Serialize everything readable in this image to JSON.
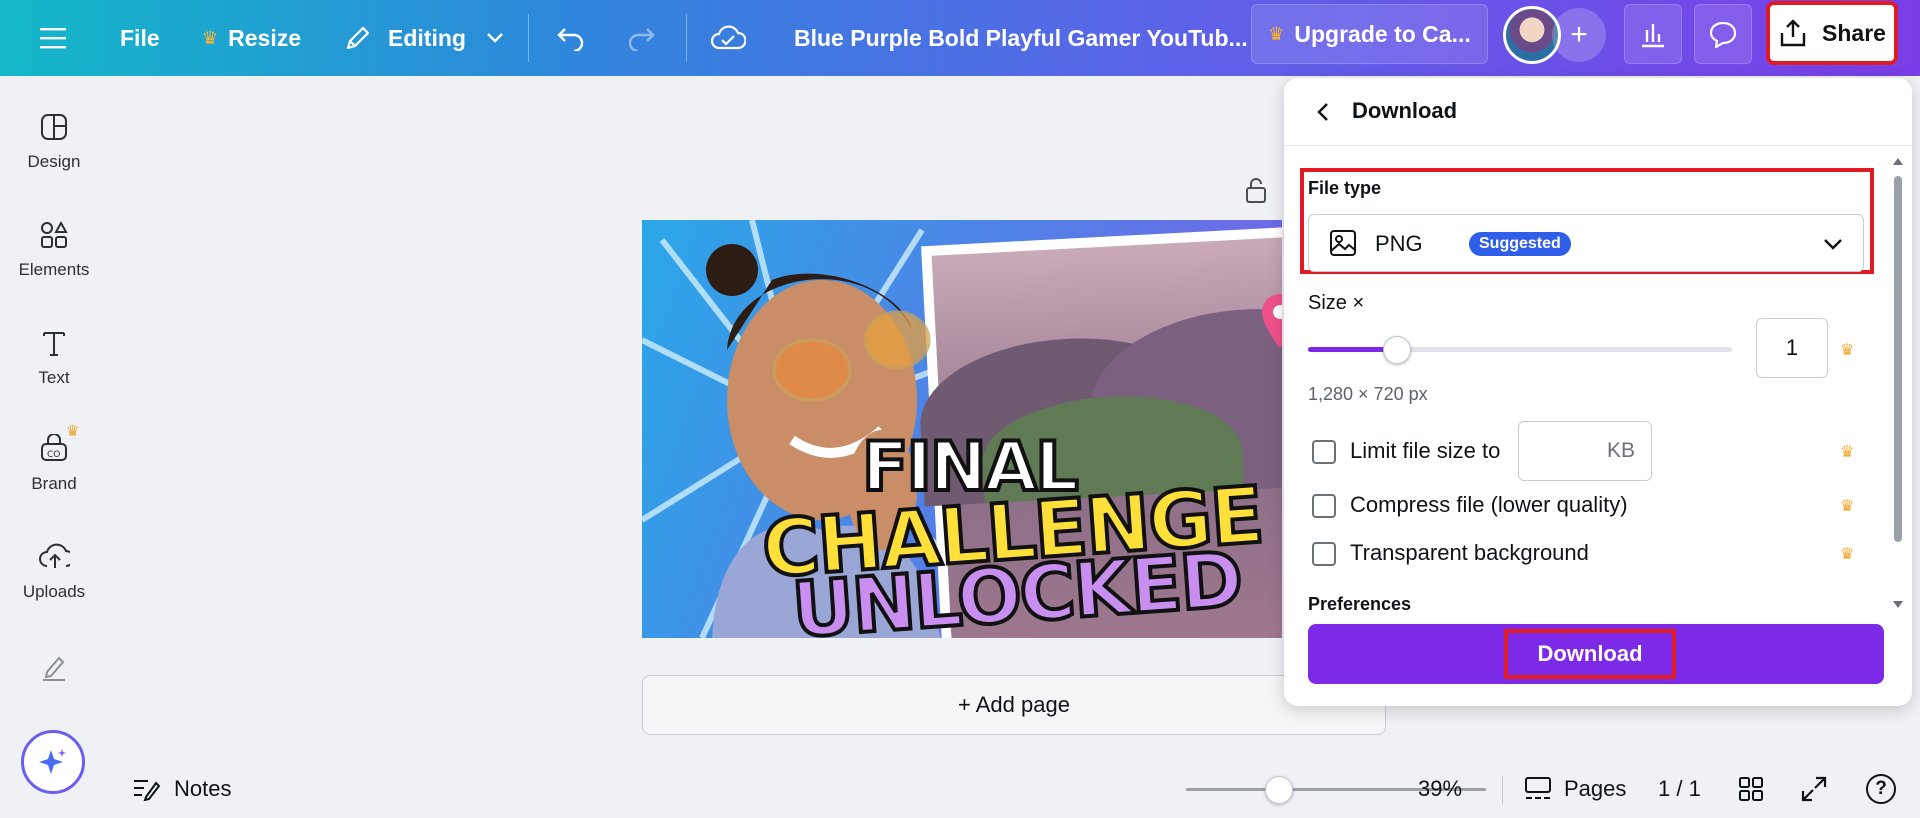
{
  "topbar": {
    "menu_icon": "hamburger-icon",
    "file_label": "File",
    "resize_label": "Resize",
    "editing_label": "Editing",
    "doc_title": "Blue Purple Bold Playful Gamer YouTub...",
    "upgrade_label": "Upgrade to Ca...",
    "share_label": "Share"
  },
  "sidebar": {
    "items": [
      {
        "label": "Design",
        "icon": "design-icon"
      },
      {
        "label": "Elements",
        "icon": "elements-icon"
      },
      {
        "label": "Text",
        "icon": "text-icon"
      },
      {
        "label": "Brand",
        "icon": "brand-icon"
      },
      {
        "label": "Uploads",
        "icon": "uploads-icon"
      },
      {
        "label": "",
        "icon": "draw-icon"
      }
    ]
  },
  "canvas": {
    "title_line1": "FINAL",
    "title_line2": "CHALLENGE",
    "title_line3": "UNLOCKED",
    "add_page_label": "+ Add page"
  },
  "bottombar": {
    "notes_label": "Notes",
    "zoom_level": "39%",
    "zoom_fraction": 0.31,
    "pages_label": "Pages",
    "page_counter": "1 / 1",
    "help_label": "?"
  },
  "download_panel": {
    "title": "Download",
    "file_type_label": "File type",
    "file_type_value": "PNG",
    "suggested_badge": "Suggested",
    "size_label": "Size ×",
    "size_value": "1",
    "size_fraction": 0.21,
    "dimensions": "1,280 × 720 px",
    "limit_label": "Limit file size to",
    "limit_unit": "KB",
    "compress_label": "Compress file (lower quality)",
    "transparent_label": "Transparent background",
    "preferences_label": "Preferences",
    "download_button": "Download"
  },
  "colors": {
    "accent": "#7d2ae8",
    "highlight": "#e01b24",
    "badge": "#2f5ee8",
    "crown": "#f0a524"
  }
}
